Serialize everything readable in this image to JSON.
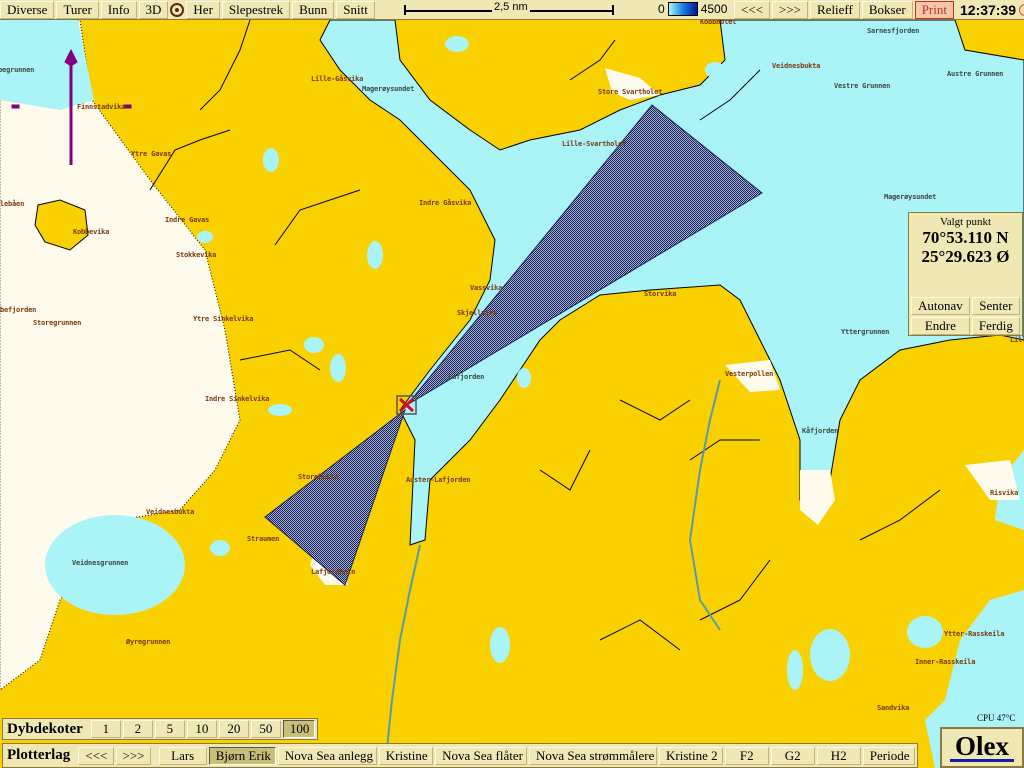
{
  "toolbar": {
    "buttons": [
      "Diverse",
      "Turer",
      "Info",
      "3D",
      "Her",
      "Slepestrek",
      "Bunn",
      "Snitt"
    ],
    "scale": "2,5 nm",
    "depth_min": "0",
    "depth_max": "4500",
    "right_buttons": [
      "<<<",
      ">>>",
      "Relieff",
      "Bokser"
    ],
    "print": "Print",
    "time": "12:37:39"
  },
  "colors": {
    "land": "#f9d000",
    "water": "#aaf4f8",
    "shallow": "#fffbec",
    "route": "#14205a",
    "arrow": "#800080",
    "marker": "#d01020",
    "panel": "#efe7b4"
  },
  "icons": {
    "her": "target-circle-icon",
    "sun": "sun-icon",
    "north": "north-arrow-icon",
    "marker": "selected-point-x-icon"
  },
  "panel": {
    "title": "Valgt punkt",
    "lat": "70°53.110 N",
    "lon": "25°29.623 Ø",
    "buttons": [
      "Autonav",
      "Senter",
      "Endre",
      "Ferdig"
    ]
  },
  "depth_contours": {
    "title": "Dybdekoter",
    "values": [
      "1",
      "2",
      "5",
      "10",
      "20",
      "50",
      "100"
    ],
    "selected": "100"
  },
  "plotterlag": {
    "title": "Plotterlag",
    "buttons": [
      "<<<",
      ">>>",
      "Lars",
      "Bjørn Erik",
      "Nova Sea anlegg",
      "Kristine",
      "Nova Sea flåter",
      "Nova Sea strømmålere",
      "Kristine 2",
      "F2",
      "G2",
      "H2",
      "Periode"
    ],
    "selected": "Bjørn Erik"
  },
  "cpu": "CPU 47°C",
  "logo": "Olex",
  "map": {
    "labels": [
      "Kobbegrunnen",
      "Finnstadvika",
      "Ytre Gavas",
      "Lille-Gåsvika",
      "Magerøysundet",
      "Store Svartholet",
      "Lille-Svartholet",
      "Kobbholet",
      "Sarnesfjorden",
      "Veidnesbukta",
      "Vestre Grunnen",
      "Austre Grunnen",
      "Magerøysundet",
      "Indre Gåsvika",
      "Indre Gavas",
      "Kobbevika",
      "lebåen",
      "befjorden",
      "Storegrunnen",
      "Stokkevika",
      "Ytre Sinkelvika",
      "Vassvika",
      "Skjellvika",
      "Storvika",
      "Yttergrunnen",
      "Lille-P",
      "Lafjorden",
      "Vesterpollen",
      "Indre Sinkelvika",
      "Kåfjorden",
      "Auster-Lafjorden",
      "Storebukta",
      "Veidnesbukta",
      "Straumen",
      "Risvika",
      "Veidnesgrunnen",
      "Lafjordbotn",
      "Øyregrunnen",
      "Ytter-Rasskeila",
      "Inner-Rasskeila",
      "Sandvika"
    ]
  }
}
